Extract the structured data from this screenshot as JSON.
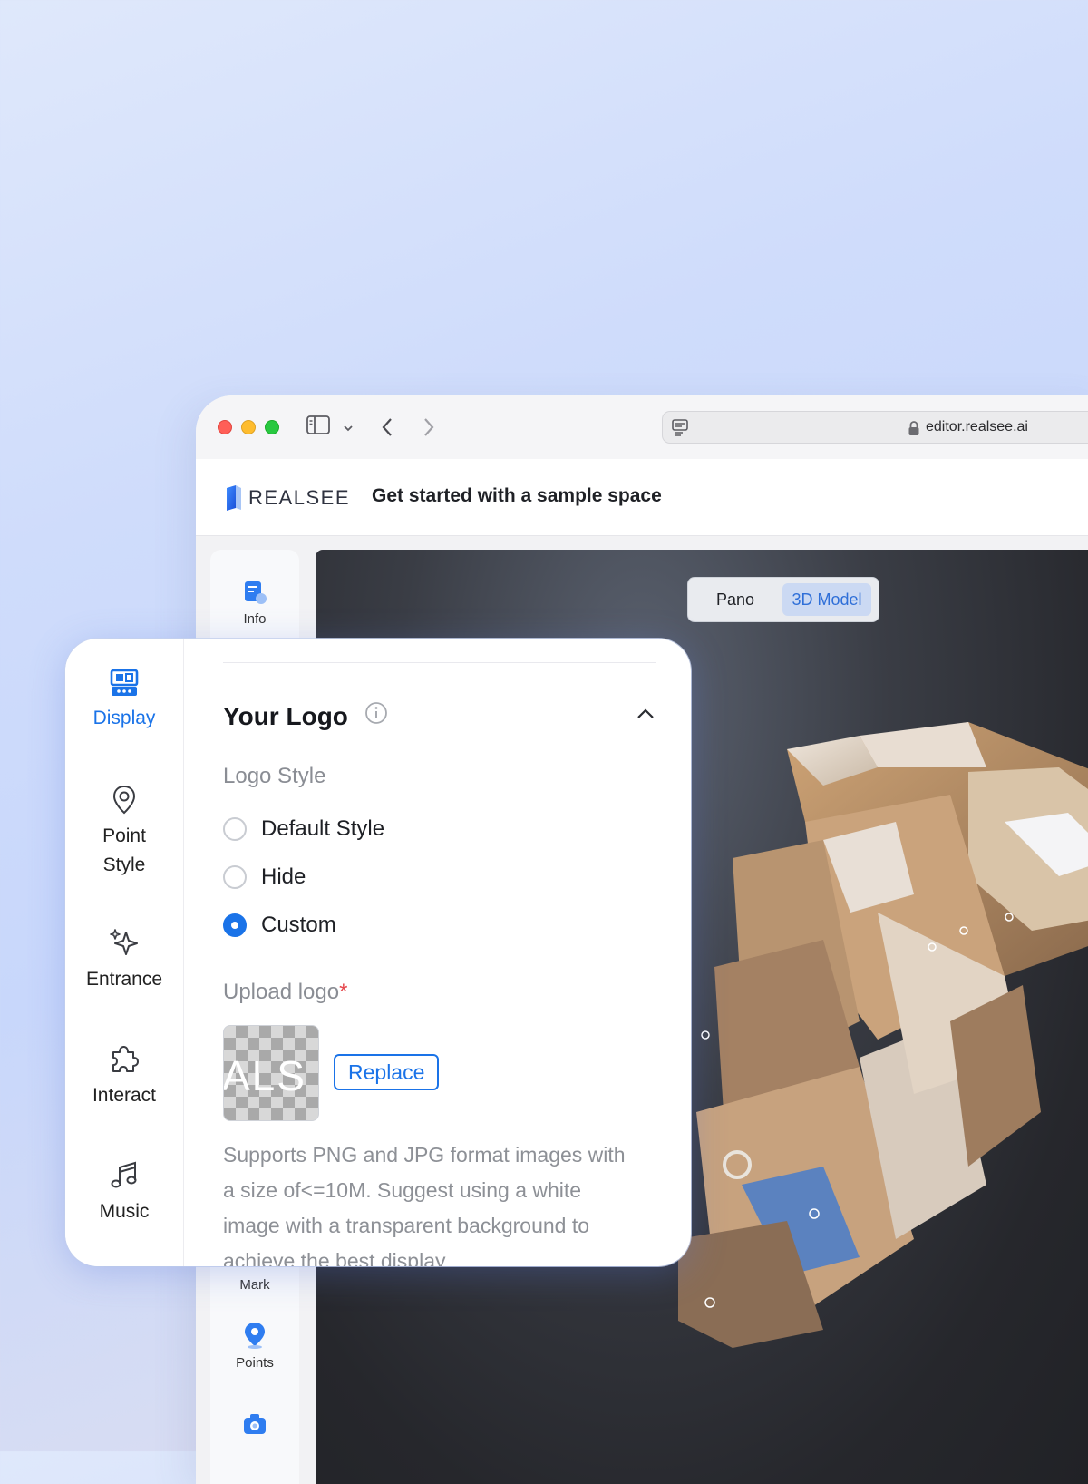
{
  "browser": {
    "url": "editor.realsee.ai"
  },
  "app": {
    "brand": "REALSEE",
    "title": "Get started with a sample space"
  },
  "left_rail": {
    "items": [
      {
        "label": "Info",
        "icon": "info-doc-icon"
      },
      {
        "label": "Mark",
        "icon": "mark-icon"
      },
      {
        "label": "Points",
        "icon": "location-pin-icon"
      },
      {
        "label": "",
        "icon": "camera-icon"
      }
    ]
  },
  "viewport": {
    "modes": [
      "Pano",
      "3D Model"
    ],
    "active_mode": "3D Model"
  },
  "panel": {
    "nav": [
      {
        "label": "Display",
        "icon": "display-icon",
        "active": true
      },
      {
        "label": "Point Style",
        "icon": "map-pin-icon",
        "active": false
      },
      {
        "label": "Entrance",
        "icon": "sparkle-icon",
        "active": false
      },
      {
        "label": "Interact",
        "icon": "puzzle-icon",
        "active": false
      },
      {
        "label": "Music",
        "icon": "music-note-icon",
        "active": false
      }
    ],
    "section_title": "Your Logo",
    "logo_style_label": "Logo Style",
    "options": [
      "Default Style",
      "Hide",
      "Custom"
    ],
    "selected_option": "Custom",
    "upload_label": "Upload logo",
    "required_mark": "*",
    "logo_preview_text": "ALS",
    "replace_label": "Replace",
    "help_text": "Supports PNG and JPG format images with a size of<=10M. Suggest using a white image with a transparent background to achieve the best display"
  },
  "colors": {
    "accent": "#1a73e8",
    "active_mode_bg": "#cbd9f3"
  }
}
